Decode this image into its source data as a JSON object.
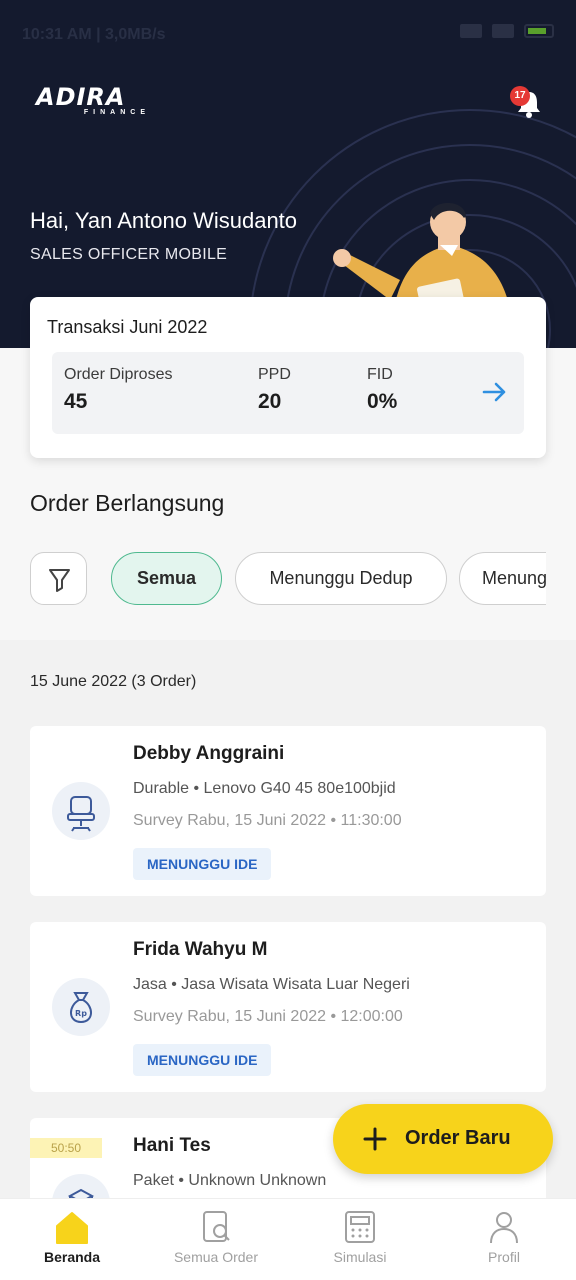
{
  "status_bar": {
    "time": "10:31 AM | 3,0MB/s"
  },
  "header": {
    "logo_main": "ADIRA",
    "logo_sub": "FINANCE",
    "notification_count": "17",
    "greeting": "Hai, Yan Antono Wisudanto",
    "role": "SALES OFFICER MOBILE"
  },
  "stats": {
    "title": "Transaksi Juni 2022",
    "items": [
      {
        "label": "Order Diproses",
        "value": "45"
      },
      {
        "label": "PPD",
        "value": "20"
      },
      {
        "label": "FID",
        "value": "0%"
      }
    ]
  },
  "orders_section": {
    "title": "Order Berlangsung",
    "filters": [
      "Semua",
      "Menunggu Dedup",
      "Menunggu IDE"
    ],
    "active_filter": "Semua",
    "date_group": "15 June 2022 (3 Order)",
    "orders": [
      {
        "name": "Debby Anggraini",
        "description": "Durable • Lenovo G40 45 80e100bjid",
        "survey": "Survey Rabu, 15 Juni 2022 • 11:30:00",
        "status": "MENUNGGU IDE",
        "icon": "chair-icon"
      },
      {
        "name": "Frida Wahyu M",
        "description": "Jasa • Jasa Wisata Wisata Luar Negeri",
        "survey": "Survey Rabu, 15 Juni 2022 • 12:00:00",
        "status": "MENUNGGU IDE",
        "icon": "money-bag-icon"
      },
      {
        "name": "Hani Tes",
        "description": "Paket • Unknown Unknown",
        "tag": "50:50",
        "icon": "package-icon"
      }
    ]
  },
  "fab": {
    "label": "Order Baru"
  },
  "bottom_nav": [
    {
      "label": "Beranda",
      "icon": "home-icon",
      "active": true
    },
    {
      "label": "Semua Order",
      "icon": "order-search-icon",
      "active": false
    },
    {
      "label": "Simulasi",
      "icon": "calculator-icon",
      "active": false
    },
    {
      "label": "Profil",
      "icon": "person-icon",
      "active": false
    }
  ],
  "colors": {
    "hero_bg": "#141a2e",
    "accent_yellow": "#f7d31b",
    "active_chip_bg": "#e3f5ee",
    "active_chip_border": "#4fb98f",
    "badge_text": "#2a66c4",
    "arrow_blue": "#2f8fe0"
  }
}
